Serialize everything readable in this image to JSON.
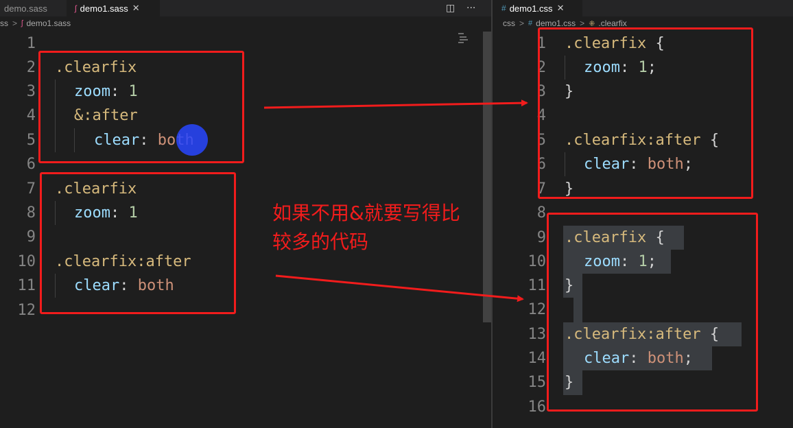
{
  "left_editor": {
    "tabs": [
      {
        "label": "demo.sass",
        "active": false
      },
      {
        "label": "demo1.sass",
        "active": true,
        "close": "✕"
      }
    ],
    "breadcrumb": {
      "folder": "ss",
      "file": "demo1.sass"
    },
    "line_numbers": [
      "1",
      "2",
      "3",
      "4",
      "5",
      "6",
      "7",
      "8",
      "9",
      "10",
      "11",
      "12"
    ],
    "code": {
      "l2_selector": ".clearfix",
      "l3_prop": "zoom",
      "l3_colon": ":",
      "l3_value": " 1",
      "l4_selector": "&:after",
      "l5_prop": "clear",
      "l5_colon": ":",
      "l5_value": " both",
      "l7_selector": ".clearfix",
      "l8_prop": "zoom",
      "l8_colon": ":",
      "l8_value": " 1",
      "l10_selector": ".clearfix:after",
      "l11_prop": "clear",
      "l11_colon": ":",
      "l11_value": " both"
    },
    "actions": {
      "split": "◫",
      "more": "···"
    }
  },
  "right_editor": {
    "tab": {
      "label": "demo1.css",
      "close": "✕",
      "icon": "#"
    },
    "breadcrumb": {
      "folder": "css",
      "file": "demo1.css",
      "symbol": ".clearfix",
      "file_icon": "#",
      "symbol_icon": "⁜"
    },
    "line_numbers": [
      "1",
      "2",
      "3",
      "4",
      "5",
      "6",
      "7",
      "8",
      "9",
      "10",
      "11",
      "12",
      "13",
      "14",
      "15",
      "16"
    ],
    "code": {
      "l1_selector": ".clearfix",
      "l1_brace": " {",
      "l2_prop": "zoom",
      "l2_colon": ":",
      "l2_value": " 1",
      "l2_semi": ";",
      "l3_brace": "}",
      "l5_selector": ".clearfix:after",
      "l5_brace": " {",
      "l6_prop": "clear",
      "l6_colon": ":",
      "l6_value": " both",
      "l6_semi": ";",
      "l7_brace": "}",
      "l9_selector": ".clearfix",
      "l9_brace": " {",
      "l10_prop": "zoom",
      "l10_colon": ":",
      "l10_value": " 1",
      "l10_semi": ";",
      "l11_brace": "}",
      "l13_selector": ".clearfix:after",
      "l13_brace": " {",
      "l14_prop": "clear",
      "l14_colon": ":",
      "l14_value": " both",
      "l14_semi": ";",
      "l15_brace": "}"
    }
  },
  "annotation": {
    "line1": "如果不用&就要写得比",
    "line2": "较多的代码"
  },
  "colors": {
    "annotation_red": "#f21c1c",
    "selector": "#d7ba7d",
    "property": "#9cdcfe",
    "number": "#b5cea8",
    "string_value": "#ce9178",
    "cursor_blue": "#2846ff"
  }
}
